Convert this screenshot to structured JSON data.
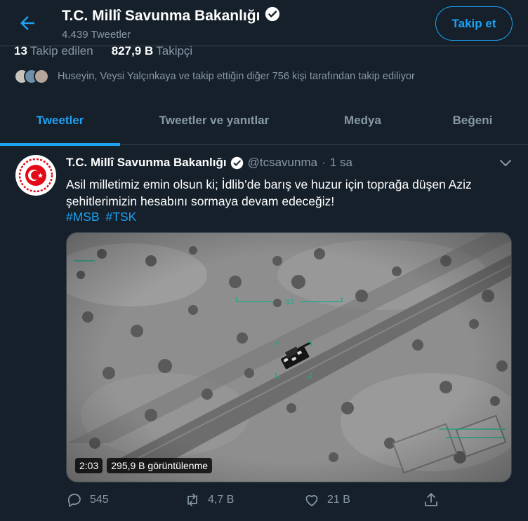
{
  "header": {
    "title": "T.C. Millî Savunma Bakanlığı",
    "tweet_count": "4.439 Tweetler",
    "follow_label": "Takip et"
  },
  "stats": {
    "following_count": "13",
    "following_label": "Takip edilen",
    "followers_count": "827,9 B",
    "followers_label": "Takipçi"
  },
  "followed_by": "Huseyin, Veysi Yalçınkaya ve takip ettiğin diğer 756 kişi tarafından takip ediliyor",
  "tabs": [
    {
      "label": "Tweetler"
    },
    {
      "label": "Tweetler ve yanıtlar"
    },
    {
      "label": "Medya"
    },
    {
      "label": "Beğeni"
    }
  ],
  "tweet": {
    "name": "T.C. Millî Savunma Bakanlığı",
    "handle": "@tcsavunma",
    "separator": "·",
    "time": "1 sa",
    "text": "Asil milletimiz emin olsun ki; İdlib’de barış ve huzur için toprağa düşen Aziz şehitlerimizin hesabını sormaya devam edeceğiz!",
    "hashtags": [
      "#MSB",
      "#TSK"
    ],
    "media": {
      "duration": "2:03",
      "views": "295,9 B görüntülenme",
      "hud_number": "33"
    },
    "actions": {
      "replies": "545",
      "retweets": "4,7 B",
      "likes": "21 B"
    }
  },
  "colors": {
    "background": "#15202b",
    "accent": "#1da1f2",
    "secondary_text": "#8899a6",
    "border": "#38444d"
  }
}
